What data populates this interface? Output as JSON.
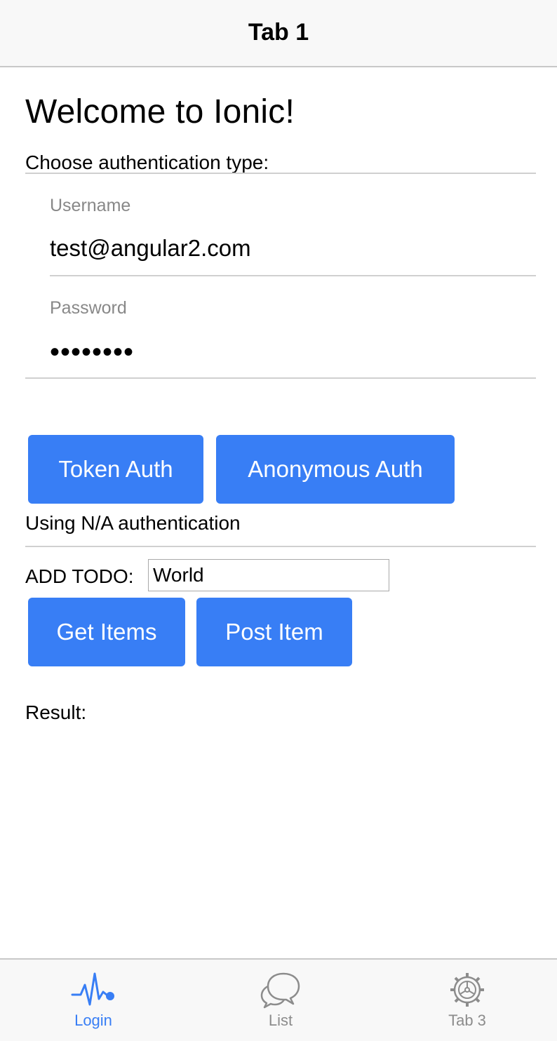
{
  "navbar": {
    "title": "Tab 1"
  },
  "main": {
    "heading": "Welcome to Ionic!",
    "auth_prompt": "Choose authentication type:",
    "username": {
      "label": "Username",
      "value": "test@angular2.com"
    },
    "password": {
      "label": "Password",
      "masked_value": "••••••••"
    },
    "buttons": {
      "token_auth": "Token Auth",
      "anonymous_auth": "Anonymous Auth"
    },
    "status": "Using N/A authentication",
    "todo": {
      "label": "ADD TODO:",
      "value": "World"
    },
    "actions": {
      "get_items": "Get Items",
      "post_item": "Post Item"
    },
    "result_label": "Result:"
  },
  "tabs": [
    {
      "label": "Login",
      "icon": "pulse-icon",
      "active": true
    },
    {
      "label": "List",
      "icon": "chat-bubbles-icon",
      "active": false
    },
    {
      "label": "Tab 3",
      "icon": "settings-gear-icon",
      "active": false
    }
  ],
  "colors": {
    "accent": "#387ef5",
    "inactive": "#8c8c8c",
    "bar_bg": "#f8f8f8"
  }
}
